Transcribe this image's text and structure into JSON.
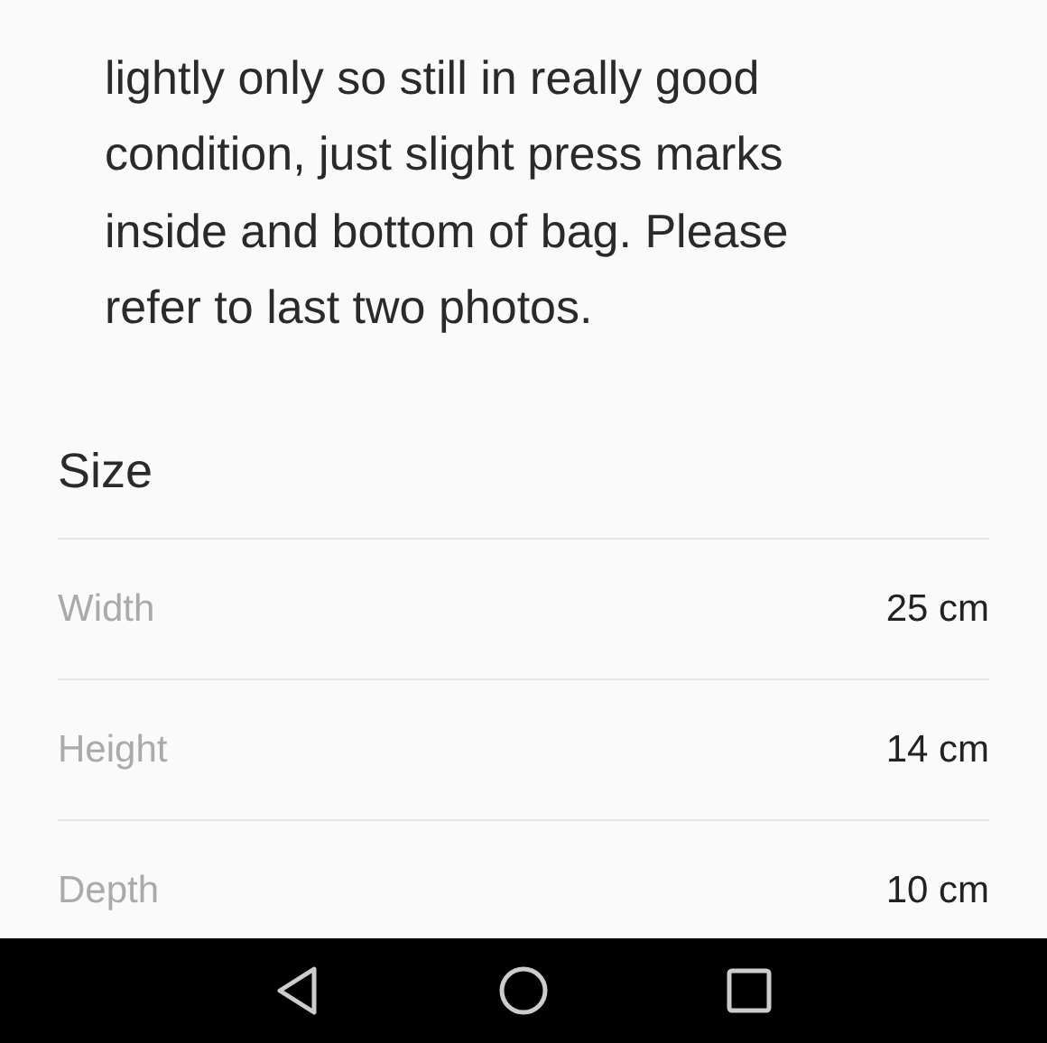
{
  "description": {
    "lines": [
      "lightly only so still in really good",
      "condition, just slight press marks",
      "inside and bottom of bag. Please",
      "refer to last two photos."
    ]
  },
  "size": {
    "title": "Size",
    "rows": [
      {
        "label": "Width",
        "value": "25 cm"
      },
      {
        "label": "Height",
        "value": "14 cm"
      },
      {
        "label": "Depth",
        "value": "10 cm"
      }
    ]
  }
}
